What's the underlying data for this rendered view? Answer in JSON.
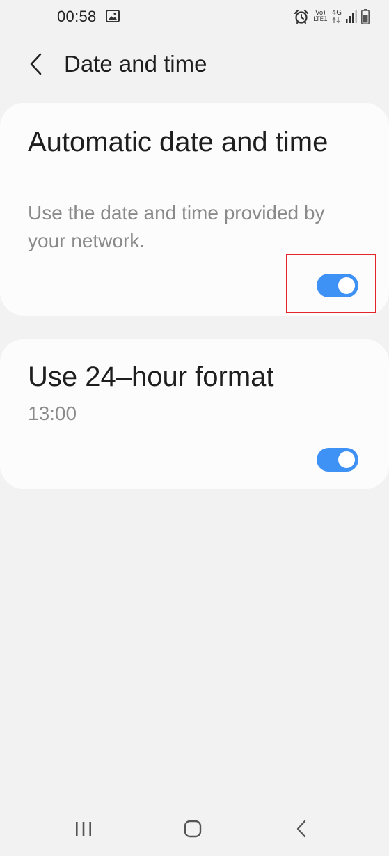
{
  "status_bar": {
    "time": "00:58",
    "icons": [
      "gallery-icon",
      "alarm-icon",
      "volte-icon",
      "4g-icon",
      "signal-icon",
      "battery-icon"
    ],
    "volte_line1": "Vo)",
    "volte_line2": "LTE1",
    "network": "4G"
  },
  "header": {
    "back_icon": "chevron-left-icon",
    "title": "Date and time"
  },
  "settings": [
    {
      "title": "Automatic date and time",
      "description": "Use the date and time provided by your network.",
      "enabled": true
    },
    {
      "title": "Use 24–hour format",
      "description": "13:00",
      "enabled": true
    }
  ],
  "colors": {
    "background": "#f2f2f2",
    "card": "#fcfcfc",
    "accent": "#3e91f5",
    "secondary_text": "#8a8a8a",
    "highlight": "#e3242b"
  },
  "nav_bar": {
    "icons": [
      "recents-icon",
      "home-icon",
      "back-icon"
    ]
  }
}
